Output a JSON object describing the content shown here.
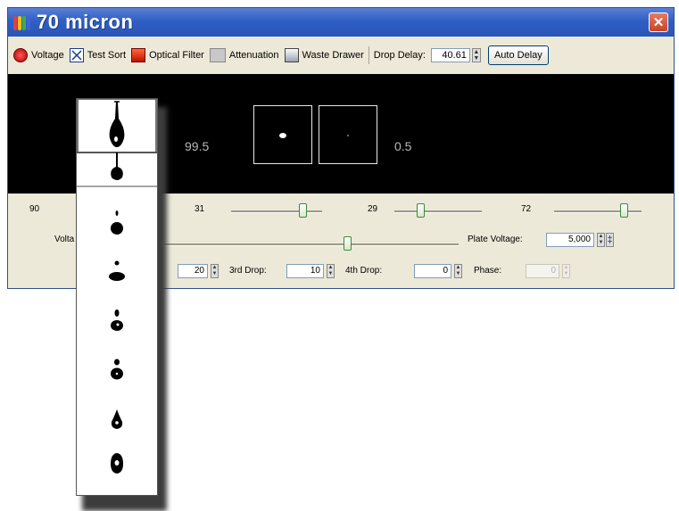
{
  "window": {
    "title": "70 micron",
    "close_glyph": "✕",
    "icon": "multicolor-bars-icon",
    "accent_color": "#2f5fc4"
  },
  "toolbar": {
    "voltage_label": "Voltage",
    "test_sort_label": "Test Sort",
    "optical_filter_label": "Optical Filter",
    "attenuation_label": "Attenuation",
    "waste_drawer_label": "Waste Drawer",
    "drop_delay_label": "Drop Delay:",
    "drop_delay_value": "40.61",
    "auto_delay_label": "Auto Delay"
  },
  "display": {
    "left_percent": "99.5",
    "right_percent": "0.5"
  },
  "sliders": {
    "s1_value": "90",
    "s2_value": "31",
    "s3_value": "29",
    "s4_value": "72",
    "s2_level": 0.78,
    "s3_level": 0.3,
    "s4_level": 0.8,
    "voltage_level": 0.62
  },
  "settings": {
    "voltage_label": "Volta",
    "plate_voltage_label": "Plate Voltage:",
    "plate_voltage_value": "5,000",
    "second_drop_value": "20",
    "third_drop_label": "3rd Drop:",
    "third_drop_value": "10",
    "fourth_drop_label": "4th Drop:",
    "fourth_drop_value": "0",
    "phase_label": "Phase:",
    "phase_value": "0"
  }
}
